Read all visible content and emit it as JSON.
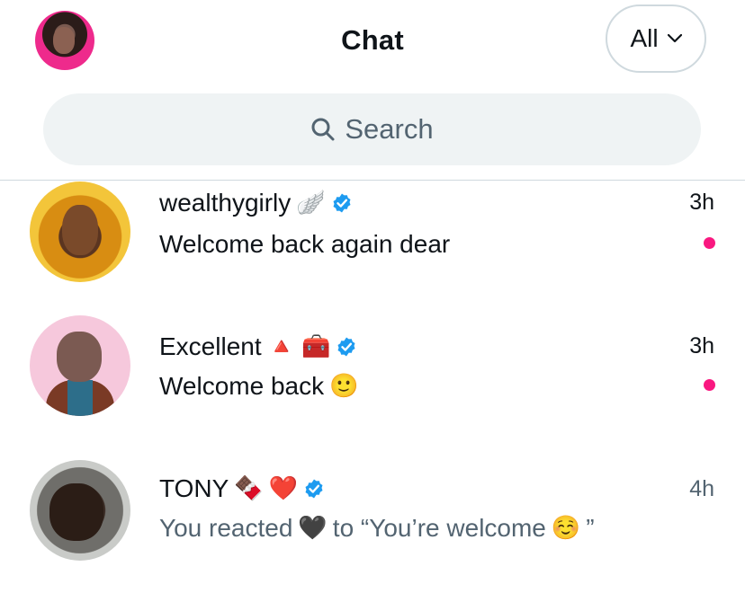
{
  "header": {
    "title": "Chat",
    "filter_label": "All"
  },
  "search": {
    "placeholder": "Search"
  },
  "conversations": [
    {
      "name": "wealthygirly",
      "name_emojis": [
        "🪽"
      ],
      "verified": true,
      "message": "Welcome back again dear",
      "message_emojis": [],
      "time": "3h",
      "unread": true
    },
    {
      "name": "Excellent",
      "name_emojis": [
        "🔺",
        "🧰"
      ],
      "verified": true,
      "message": "Welcome back",
      "message_emojis": [
        "🙂"
      ],
      "time": "3h",
      "unread": true
    },
    {
      "name": "TONY",
      "name_emojis": [
        "🍫",
        "❤️"
      ],
      "verified": true,
      "message_prefix": "You reacted",
      "message_reaction": "🖤",
      "message_suffix": "to “You’re welcome",
      "message_suffix_emoji": "☺️",
      "message_close": "”",
      "time": "4h",
      "unread": false
    }
  ],
  "colors": {
    "accent_unread": "#f91880",
    "verified_blue": "#1d9bf0",
    "muted_text": "#536471",
    "search_bg": "#eff3f4"
  },
  "icons": {
    "search": "search-icon",
    "chevron": "chevron-down-icon",
    "verified": "verified-badge-icon"
  }
}
